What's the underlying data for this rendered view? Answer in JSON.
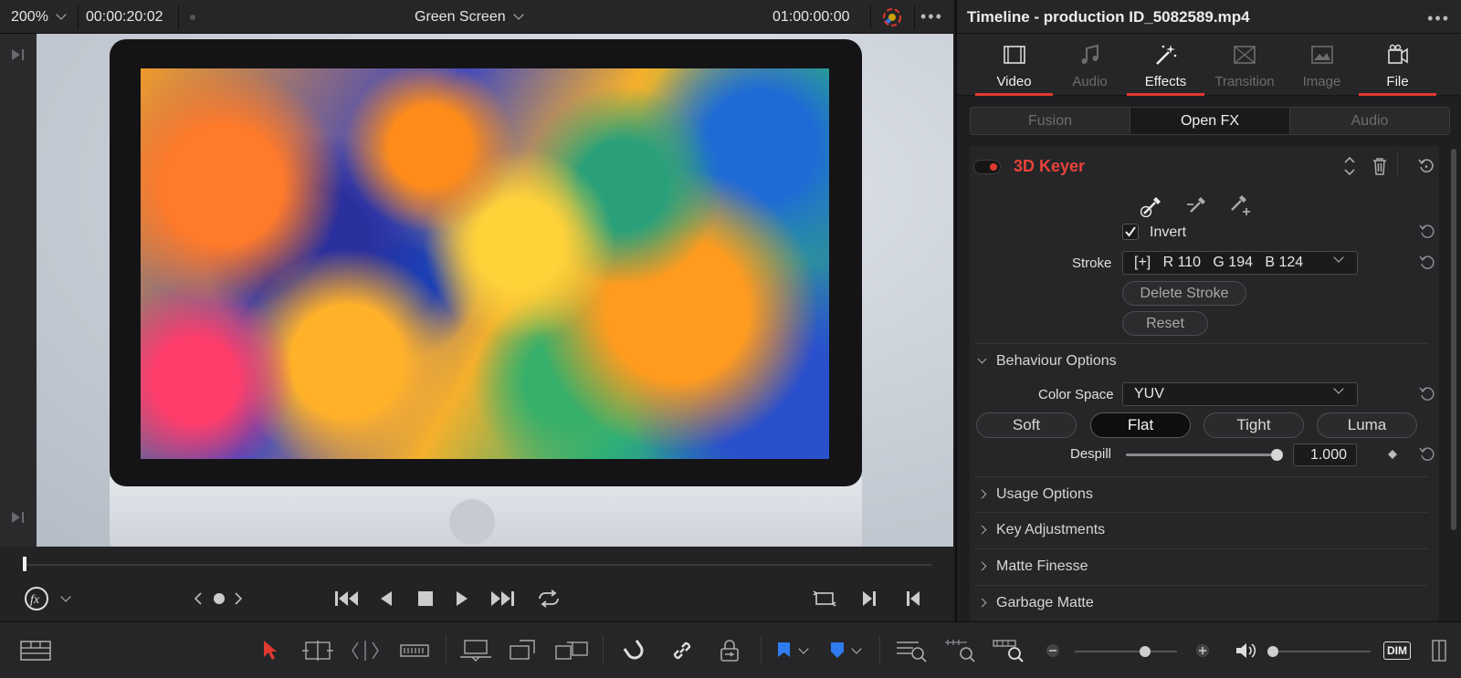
{
  "viewer_bar": {
    "zoom": "200%",
    "timecode": "00:00:20:02",
    "clip_name": "Green Screen",
    "record_timecode": "01:00:00:00"
  },
  "inspector": {
    "title": "Timeline - production ID_5082589.mp4",
    "tabs": [
      {
        "label": "Video",
        "icon": "film-strip-icon"
      },
      {
        "label": "Audio",
        "icon": "music-note-icon"
      },
      {
        "label": "Effects",
        "icon": "magic-wand-icon"
      },
      {
        "label": "Transition",
        "icon": "transition-icon"
      },
      {
        "label": "Image",
        "icon": "image-icon"
      },
      {
        "label": "File",
        "icon": "file-icon"
      }
    ],
    "subtabs": [
      "Fusion",
      "Open FX",
      "Audio"
    ],
    "effect": {
      "name": "3D Keyer",
      "invert_label": "Invert",
      "stroke_label": "Stroke",
      "stroke_value": "[+]   R 110   G 194   B 124",
      "delete_stroke": "Delete Stroke",
      "reset": "Reset",
      "behaviour_section": "Behaviour Options",
      "color_space_label": "Color Space",
      "color_space_value": "YUV",
      "modes": [
        "Soft",
        "Flat",
        "Tight",
        "Luma"
      ],
      "active_mode": "Flat",
      "despill_label": "Despill",
      "despill_value": "1.000",
      "despill_level": 1.0,
      "sections": [
        "Usage Options",
        "Key Adjustments",
        "Matte Finesse",
        "Garbage Matte"
      ]
    }
  },
  "toolbar": {
    "dim_label": "DIM"
  },
  "colors": {
    "accent_red": "#e0392f",
    "effect_name_red": "#e8433a",
    "flag_blue": "#2f7cf0"
  }
}
